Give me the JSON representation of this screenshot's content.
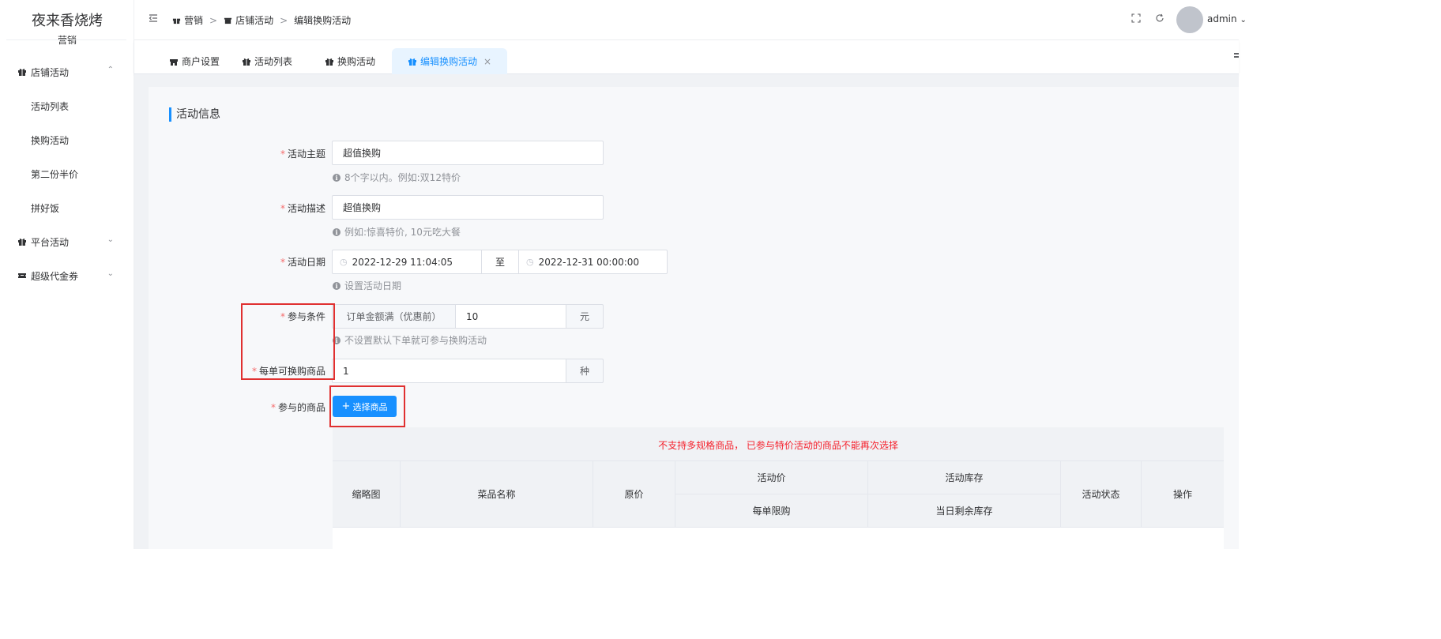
{
  "sidebar": {
    "brand": "夜来香烧烤",
    "brand_sub": "营销",
    "groups": [
      {
        "label": "店铺活动",
        "icon": "gift-icon",
        "expanded": true
      },
      {
        "label": "平台活动",
        "icon": "gift-icon",
        "expanded": false
      },
      {
        "label": "超级代金券",
        "icon": "ticket-icon",
        "expanded": false
      }
    ],
    "items": [
      "活动列表",
      "换购活动",
      "第二份半价",
      "拼好饭"
    ]
  },
  "header": {
    "breadcrumb": [
      "营销",
      "店铺活动",
      "编辑换购活动"
    ],
    "breadcrumb_sep": ">",
    "user": "admin"
  },
  "tabs": [
    {
      "label": "商户设置",
      "icon": "store-icon"
    },
    {
      "label": "活动列表",
      "icon": "gift-icon"
    },
    {
      "label": "换购活动",
      "icon": "gift-icon"
    },
    {
      "label": "编辑换购活动",
      "icon": "gift-icon",
      "active": true,
      "close": "×"
    }
  ],
  "form": {
    "section_title": "活动信息",
    "required_mark": "*",
    "theme": {
      "label": "活动主题",
      "value": "超值换购",
      "hint": "8个字以内。例如:双12特价"
    },
    "desc": {
      "label": "活动描述",
      "value": "超值换购",
      "hint": "例如:惊喜特价, 10元吃大餐"
    },
    "date": {
      "label": "活动日期",
      "start": "2022-12-29 11:04:05",
      "sep": "至",
      "end": "2022-12-31 00:00:00",
      "hint": "设置活动日期"
    },
    "condition": {
      "label": "参与条件",
      "prefix": "订单金额满（优惠前）",
      "value": "10",
      "suffix": "元",
      "hint": "不设置默认下单就可参与换购活动"
    },
    "per_order": {
      "label": "每单可换购商品",
      "value": "1",
      "suffix": "种"
    },
    "goods": {
      "label": "参与的商品",
      "button": "选择商品",
      "button_plus": "+"
    }
  },
  "table": {
    "warning": "不支持多规格商品， 已参与特价活动的商品不能再次选择",
    "headers": {
      "thumb": "缩略图",
      "name": "菜品名称",
      "price": "原价",
      "act_price": "活动价",
      "limit": "每单限购",
      "stock": "活动库存",
      "remain": "当日剩余库存",
      "status": "活动状态",
      "ops": "操作"
    }
  },
  "colors": {
    "primary": "#1890ff",
    "warning": "#f5222d",
    "highlight_box": "#e03030"
  }
}
